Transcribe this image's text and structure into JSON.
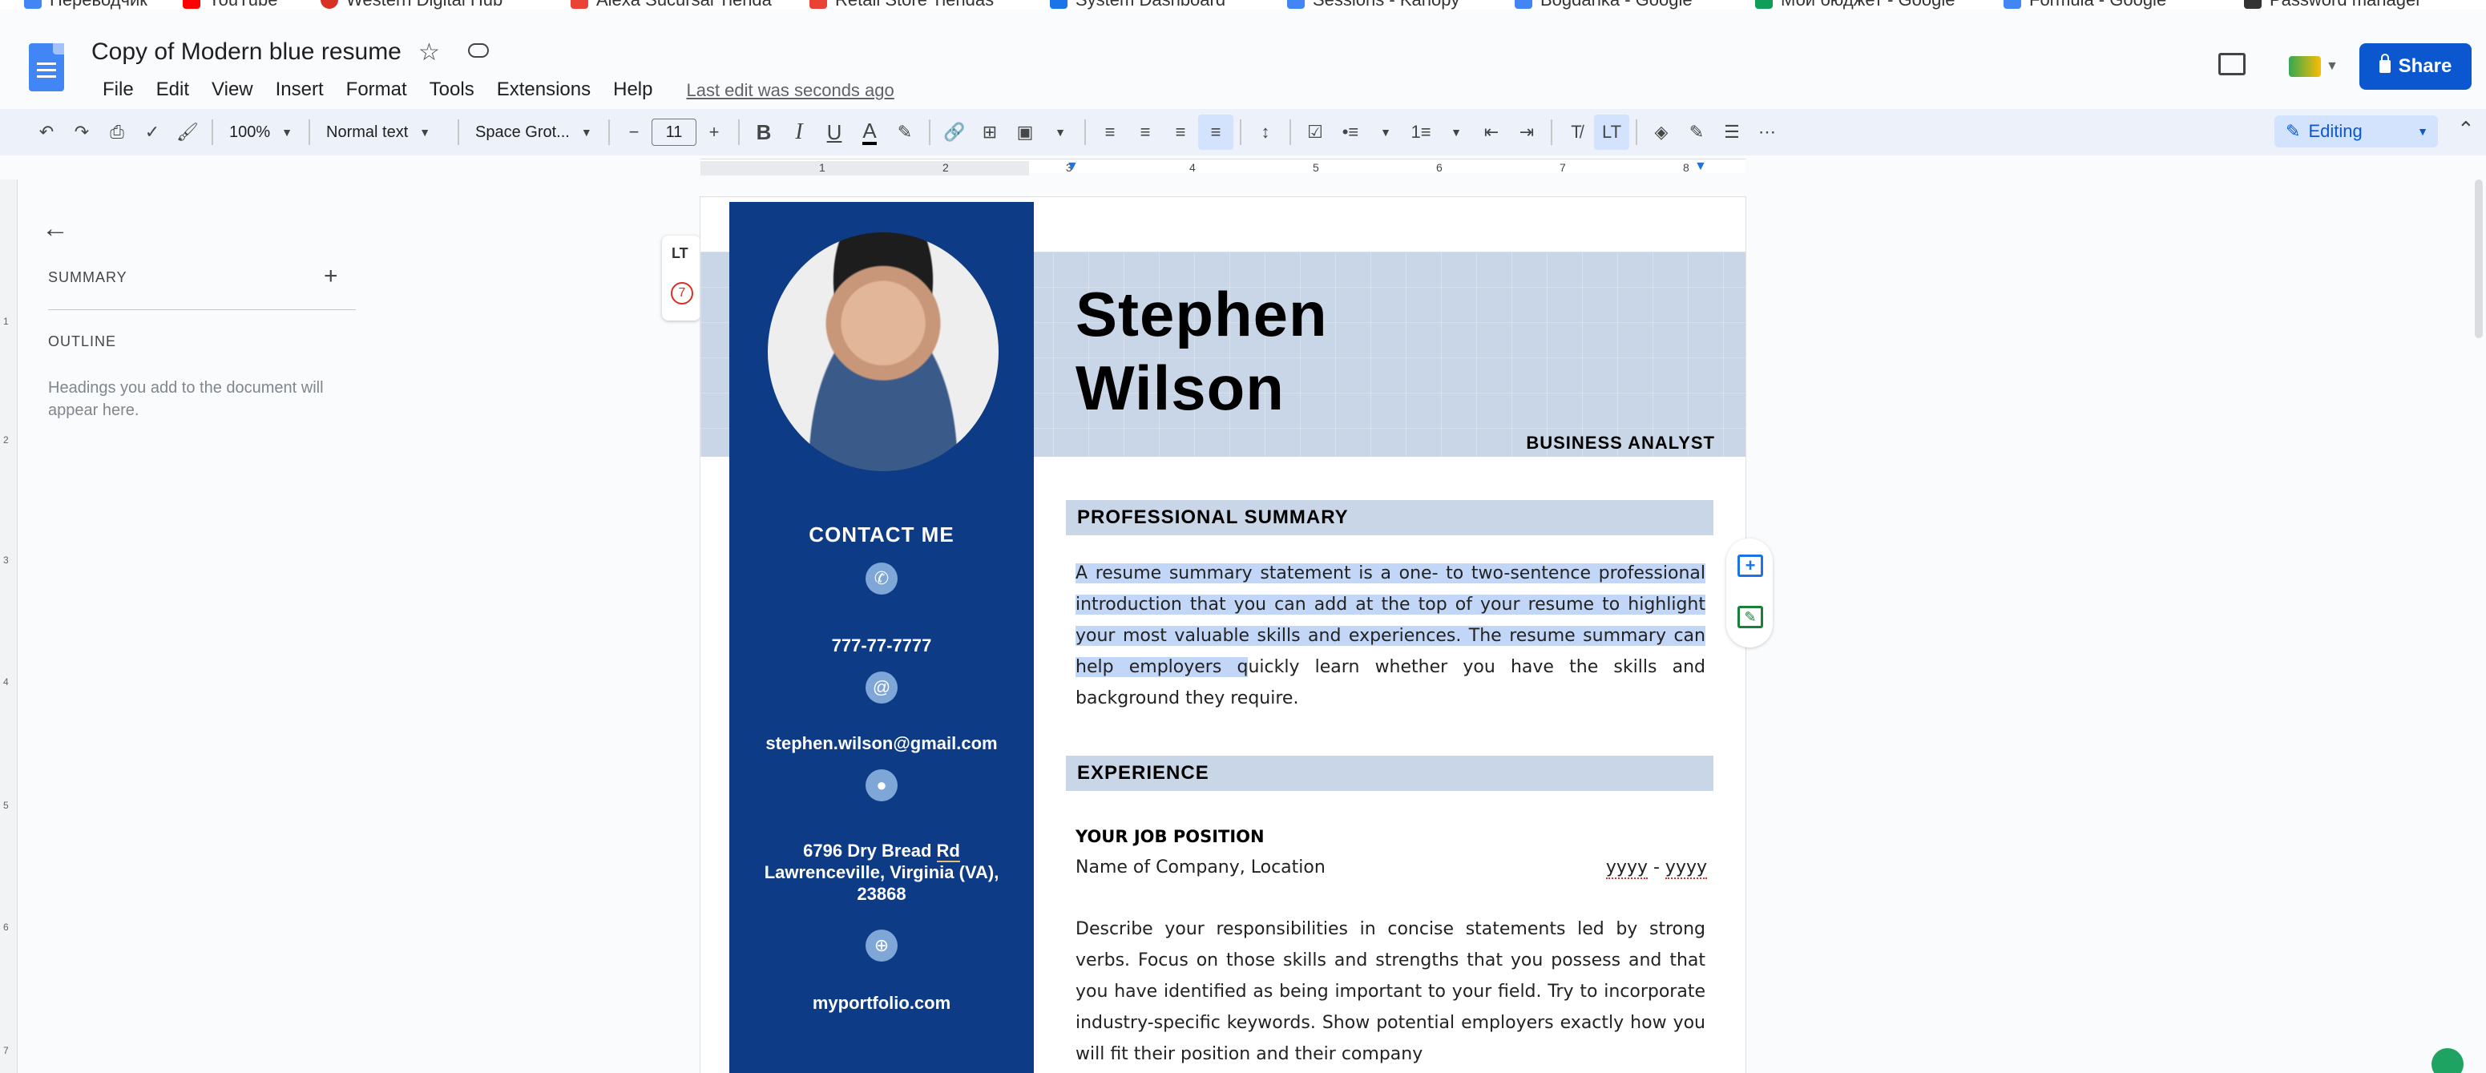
{
  "bookmarks": [
    "Переводчик",
    "YouTube",
    "Western Digital Hub",
    "Alexa Sucursal Tienda",
    "Retail Store Tiendas",
    "System Dashboard",
    "Sessions - Kanopy",
    "Bogdanka - Google",
    "Мой бюджет - Google",
    "Formula - Google",
    "Password manager"
  ],
  "title_bar": {
    "doc_title": "Copy of Modern blue resume",
    "menu": [
      "File",
      "Edit",
      "View",
      "Insert",
      "Format",
      "Tools",
      "Extensions",
      "Help"
    ],
    "last_edit": "Last edit was seconds ago",
    "share_label": "Share"
  },
  "toolbar": {
    "zoom": "100%",
    "style": "Normal text",
    "font": "Space Grot...",
    "font_size": "11",
    "mode": "Editing"
  },
  "ruler": {
    "numbers": [
      "1",
      "2",
      "3",
      "4",
      "5",
      "6",
      "7",
      "8"
    ]
  },
  "vruler": {
    "numbers": [
      "1",
      "2",
      "3",
      "4",
      "5",
      "6",
      "7"
    ]
  },
  "sidebar": {
    "summary": "SUMMARY",
    "outline": "OUTLINE",
    "hint": "Headings you add to the document will appear here."
  },
  "resume": {
    "first_name": "Stephen",
    "last_name": "Wilson",
    "job_title": "BUSINESS ANALYST",
    "contact_title": "CONTACT ME",
    "phone": "777-77-7777",
    "email": "stephen.wilson@gmail.com",
    "address_line1_pre": "6796 Dry Bread ",
    "address_line1_rd": "Rd",
    "address_line2": "Lawrenceville, Virginia (VA),",
    "address_line3": "23868",
    "website": "myportfolio.com",
    "summary_heading": "PROFESSIONAL SUMMARY",
    "summary_selected": "A resume summary statement is a one- to two-sentence professional introduction that you can add at the top of your resume to highlight your most valuable skills and experiences. The resume summary can help employers q",
    "summary_rest": "uickly learn whether you have the skills and background they require.",
    "experience_heading": "EXPERIENCE",
    "job_position": "YOUR JOB POSITION",
    "company": "Name of Company, Location",
    "dates_start": "yyyy",
    "dates_sep": " - ",
    "dates_end": "yyyy",
    "job_description": "Describe your responsibilities in concise statements led by strong verbs. Focus on those skills and strengths that you possess and that you have identified as being important to your field. Try to incorporate industry-specific keywords. Show potential employers exactly how you will fit their position and their company"
  },
  "languagetool": {
    "logo": "LT",
    "count": "7"
  },
  "colors": {
    "accent": "#0b57d0",
    "resume_blue": "#0d3b86",
    "band": "#c9d6e7",
    "selection": "#c2d7f7"
  }
}
